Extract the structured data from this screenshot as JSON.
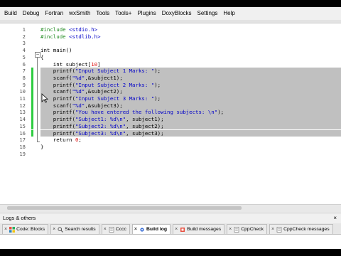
{
  "menubar": {
    "items": [
      "Build",
      "Debug",
      "Fortran",
      "wxSmith",
      "Tools",
      "Tools+",
      "Plugins",
      "DoxyBlocks",
      "Settings",
      "Help"
    ]
  },
  "editor": {
    "lines": [
      {
        "n": "1",
        "tokens": [
          {
            "t": "#include ",
            "c": "pp"
          },
          {
            "t": "<stdio.h>",
            "c": "str"
          }
        ]
      },
      {
        "n": "2",
        "tokens": [
          {
            "t": "#include ",
            "c": "pp"
          },
          {
            "t": "<stdlib.h>",
            "c": "str"
          }
        ]
      },
      {
        "n": "3",
        "tokens": []
      },
      {
        "n": "4",
        "tokens": [
          {
            "t": "int main()",
            "c": ""
          }
        ]
      },
      {
        "n": "5",
        "tokens": [
          {
            "t": "{",
            "c": ""
          }
        ]
      },
      {
        "n": "6",
        "tokens": [
          {
            "t": "    int subject[",
            "c": ""
          },
          {
            "t": "10",
            "c": "num"
          },
          {
            "t": "]",
            "c": ""
          }
        ]
      },
      {
        "n": "7",
        "sel": true,
        "tokens": [
          {
            "t": "    printf(",
            "c": ""
          },
          {
            "t": "\"Input Subject 1 Marks: \"",
            "c": "str"
          },
          {
            "t": ");",
            "c": ""
          }
        ]
      },
      {
        "n": "8",
        "sel": true,
        "tokens": [
          {
            "t": "    scanf(",
            "c": ""
          },
          {
            "t": "\"%d\"",
            "c": "str"
          },
          {
            "t": ",&subject1);",
            "c": ""
          }
        ]
      },
      {
        "n": "9",
        "sel": true,
        "tokens": [
          {
            "t": "    printf(",
            "c": ""
          },
          {
            "t": "\"Input Subject 2 Marks: \"",
            "c": "str"
          },
          {
            "t": ");",
            "c": ""
          }
        ]
      },
      {
        "n": "10",
        "sel": true,
        "tokens": [
          {
            "t": "    scanf(",
            "c": ""
          },
          {
            "t": "\"%d\"",
            "c": "str"
          },
          {
            "t": ",&subject2);",
            "c": ""
          }
        ]
      },
      {
        "n": "11",
        "sel": true,
        "tokens": [
          {
            "t": "    printf(",
            "c": ""
          },
          {
            "t": "\"Input Subject 3 Marks: \"",
            "c": "str"
          },
          {
            "t": ");",
            "c": ""
          }
        ]
      },
      {
        "n": "12",
        "sel": true,
        "tokens": [
          {
            "t": "    scanf(",
            "c": ""
          },
          {
            "t": "\"%d\"",
            "c": "str"
          },
          {
            "t": ",&subject3);",
            "c": ""
          }
        ]
      },
      {
        "n": "13",
        "sel": true,
        "tokens": [
          {
            "t": "    printf(",
            "c": ""
          },
          {
            "t": "\"You have entered the following subjects: \\n\"",
            "c": "str"
          },
          {
            "t": ");",
            "c": ""
          }
        ]
      },
      {
        "n": "14",
        "sel": true,
        "tokens": [
          {
            "t": "    printf(",
            "c": ""
          },
          {
            "t": "\"Subject1: %d\\n\"",
            "c": "str"
          },
          {
            "t": ", subject1);",
            "c": ""
          }
        ]
      },
      {
        "n": "15",
        "sel": true,
        "tokens": [
          {
            "t": "    printf(",
            "c": ""
          },
          {
            "t": "\"Subject2: %d\\n\"",
            "c": "str"
          },
          {
            "t": ", subject2);",
            "c": ""
          }
        ]
      },
      {
        "n": "16",
        "sel": true,
        "tokens": [
          {
            "t": "    printf(",
            "c": ""
          },
          {
            "t": "\"Subject3: %d\\n\"",
            "c": "str"
          },
          {
            "t": ", subject3);",
            "c": ""
          }
        ]
      },
      {
        "n": "17",
        "tokens": [
          {
            "t": "    return ",
            "c": ""
          },
          {
            "t": "0",
            "c": "num"
          },
          {
            "t": ";",
            "c": ""
          }
        ]
      },
      {
        "n": "18",
        "tokens": [
          {
            "t": "}",
            "c": ""
          }
        ]
      },
      {
        "n": "19",
        "tokens": []
      }
    ],
    "changed_lines": [
      "7",
      "8",
      "9",
      "10",
      "11",
      "12",
      "13",
      "14",
      "15",
      "16"
    ],
    "colors": {
      "preprocessor": "#1e8a1e",
      "string": "#0000c8",
      "number": "#e01010",
      "selection": "#c0c0c0",
      "changed": "#2ecc40"
    }
  },
  "logs_panel": {
    "title": "Logs & others",
    "tabs": [
      {
        "label": "Code::Blocks",
        "icon": "codeblocks-icon",
        "active": false
      },
      {
        "label": "Search results",
        "icon": "search-icon",
        "active": false
      },
      {
        "label": "Cccc",
        "icon": "document-icon",
        "active": false
      },
      {
        "label": "Build log",
        "icon": "gear-icon",
        "active": true
      },
      {
        "label": "Build messages",
        "icon": "build-icon",
        "active": false
      },
      {
        "label": "CppCheck",
        "icon": "document-icon",
        "active": false
      },
      {
        "label": "CppCheck messages",
        "icon": "document-icon",
        "active": false
      }
    ]
  }
}
